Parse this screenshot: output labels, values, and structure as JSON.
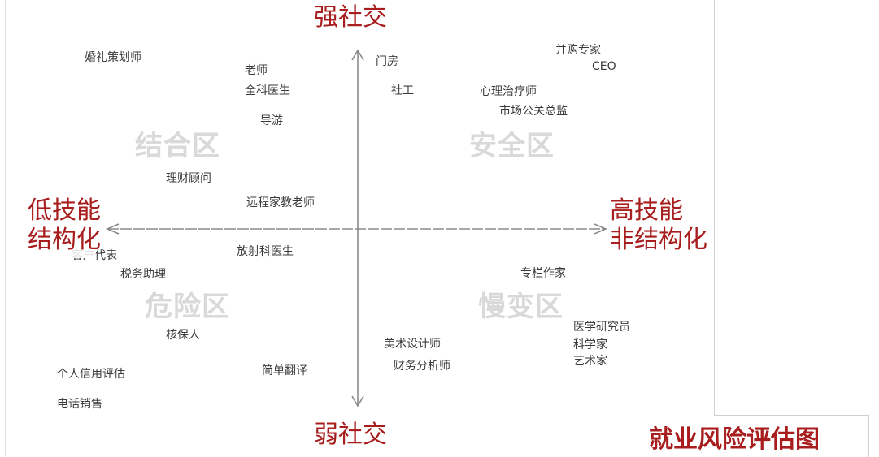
{
  "axes": {
    "top": "强社交",
    "bottom": "弱社交",
    "left": [
      "低技能",
      "结构化"
    ],
    "right": [
      "高技能",
      "非结构化"
    ]
  },
  "zones": {
    "top_left": "结合区",
    "top_right": "安全区",
    "bottom_left": "危险区",
    "bottom_right": "慢变区"
  },
  "jobs": {
    "top_left": [
      "婚礼策划师",
      "老师",
      "全科医生",
      "导游",
      "理财顾问",
      "远程家教老师"
    ],
    "top_right": [
      "门房",
      "社工",
      "并购专家",
      "CEO",
      "心理治疗师",
      "市场公关总监"
    ],
    "bottom_left": [
      "客户代表",
      "税务助理",
      "放射科医生",
      "核保人",
      "个人信用评估",
      "简单翻译",
      "电话销售"
    ],
    "bottom_right": [
      "专栏作家",
      "医学研究员",
      "科学家",
      "艺术家",
      "美术设计师",
      "财务分析师"
    ]
  },
  "title": "就业风险评估图"
}
